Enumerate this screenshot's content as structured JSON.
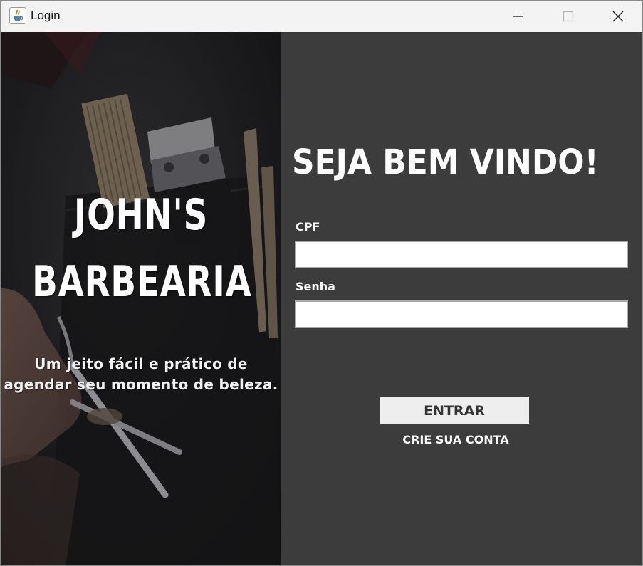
{
  "window": {
    "title": "Login",
    "icon": "java-cup-icon",
    "controls": [
      "minimize-icon",
      "maximize-icon",
      "close-icon"
    ]
  },
  "brand": {
    "line1": "JOHN'S",
    "line2": "BARBEARIA",
    "tagline_line1": "Um jeito fácil e prático de",
    "tagline_line2": "agendar seu momento de beleza."
  },
  "login": {
    "heading": "SEJA BEM VINDO!",
    "cpf_label": "CPF",
    "cpf_value": "",
    "senha_label": "Senha",
    "senha_value": "",
    "enter_button": "ENTRAR",
    "create_account_link": "CRIE SUA CONTA"
  },
  "colors": {
    "form_background": "#3c3c3c",
    "image_background": "#1f1f21",
    "text": "#ffffff",
    "button_background": "#eeeeee"
  }
}
